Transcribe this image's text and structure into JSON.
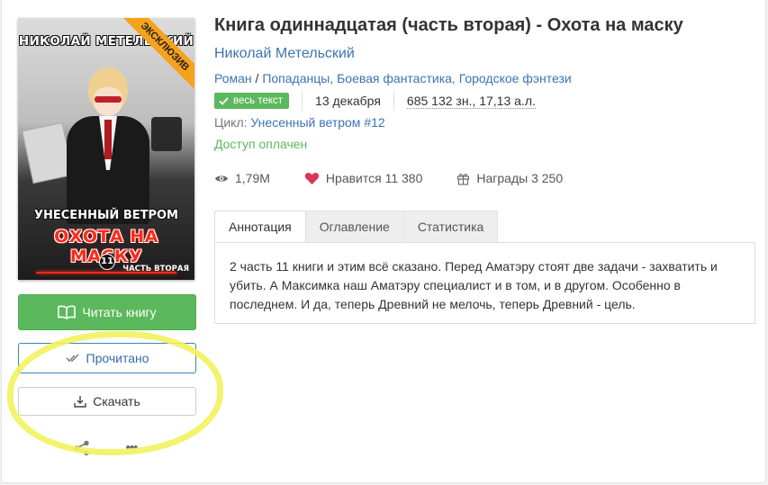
{
  "cover": {
    "author_text": "НИКОЛАЙ МЕТЕЛЬСКИЙ",
    "series_text": "УНЕСЕННЫЙ ВЕТРОМ",
    "title_text": "ОХОТА НА МАСКУ",
    "number": "11",
    "part_text": "ЧАСТЬ ВТОРАЯ",
    "ribbon": "ЭКСКЛЮЗИВ"
  },
  "actions": {
    "read_label": "Читать книгу",
    "done_label": "Прочитано",
    "download_label": "Скачать",
    "more_label": "•••"
  },
  "book": {
    "title": "Книга одиннадцатая (часть вторая) - Охота на маску",
    "author": "Николай Метельский",
    "genres": [
      "Роман",
      "Попаданцы",
      "Боевая фантастика",
      "Городское фэнтези"
    ],
    "genre_sep": " / ",
    "badge": "весь текст",
    "date": "13 декабря",
    "size": "685 132 зн., 17,13 а.л.",
    "cycle_label": "Цикл:",
    "cycle_name": "Унесенный ветром #12",
    "access": "Доступ оплачен"
  },
  "stats": {
    "views": "1,79М",
    "likes": "Нравится 11 380",
    "awards": "Награды 3 250"
  },
  "tabs": [
    "Аннотация",
    "Оглавление",
    "Статистика"
  ],
  "annotation": "2 часть 11 книги и этим всё сказано. Перед Аматэру стоят две задачи - захватить и убить. А Максимка наш Аматэру специалист и в том, и в другом. Особенно в последнем. И да, теперь Древний не мелочь, теперь Древний - цель.",
  "colors": {
    "primary_green": "#5cb85c",
    "link_blue": "#3b73b2",
    "highlight_yellow": "#f2f25e",
    "ribbon_orange": "#f7a21b",
    "heart_red": "#d9365a"
  }
}
